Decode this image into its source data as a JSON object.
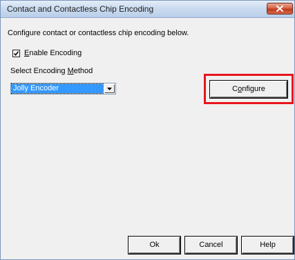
{
  "window": {
    "title": "Contact and Contactless Chip Encoding",
    "close_icon": "close-icon"
  },
  "description": "Configure contact or contactless chip encoding below.",
  "enable_encoding": {
    "checked": true,
    "label_prefix": "",
    "label_mnemonic": "E",
    "label_rest": "nable Encoding"
  },
  "encoding_method": {
    "label_prefix": "Select Encoding ",
    "label_mnemonic": "M",
    "label_rest": "ethod",
    "selected_value": "Jolly Encoder",
    "arrow_icon": "chevron-down-icon"
  },
  "configure_button": {
    "label_prefix": "C",
    "label_mnemonic": "o",
    "label_rest": "nfigure",
    "highlight_color": "#e8141c"
  },
  "footer": {
    "ok_label": "Ok",
    "cancel_label": "Cancel",
    "help_label": "Help"
  }
}
